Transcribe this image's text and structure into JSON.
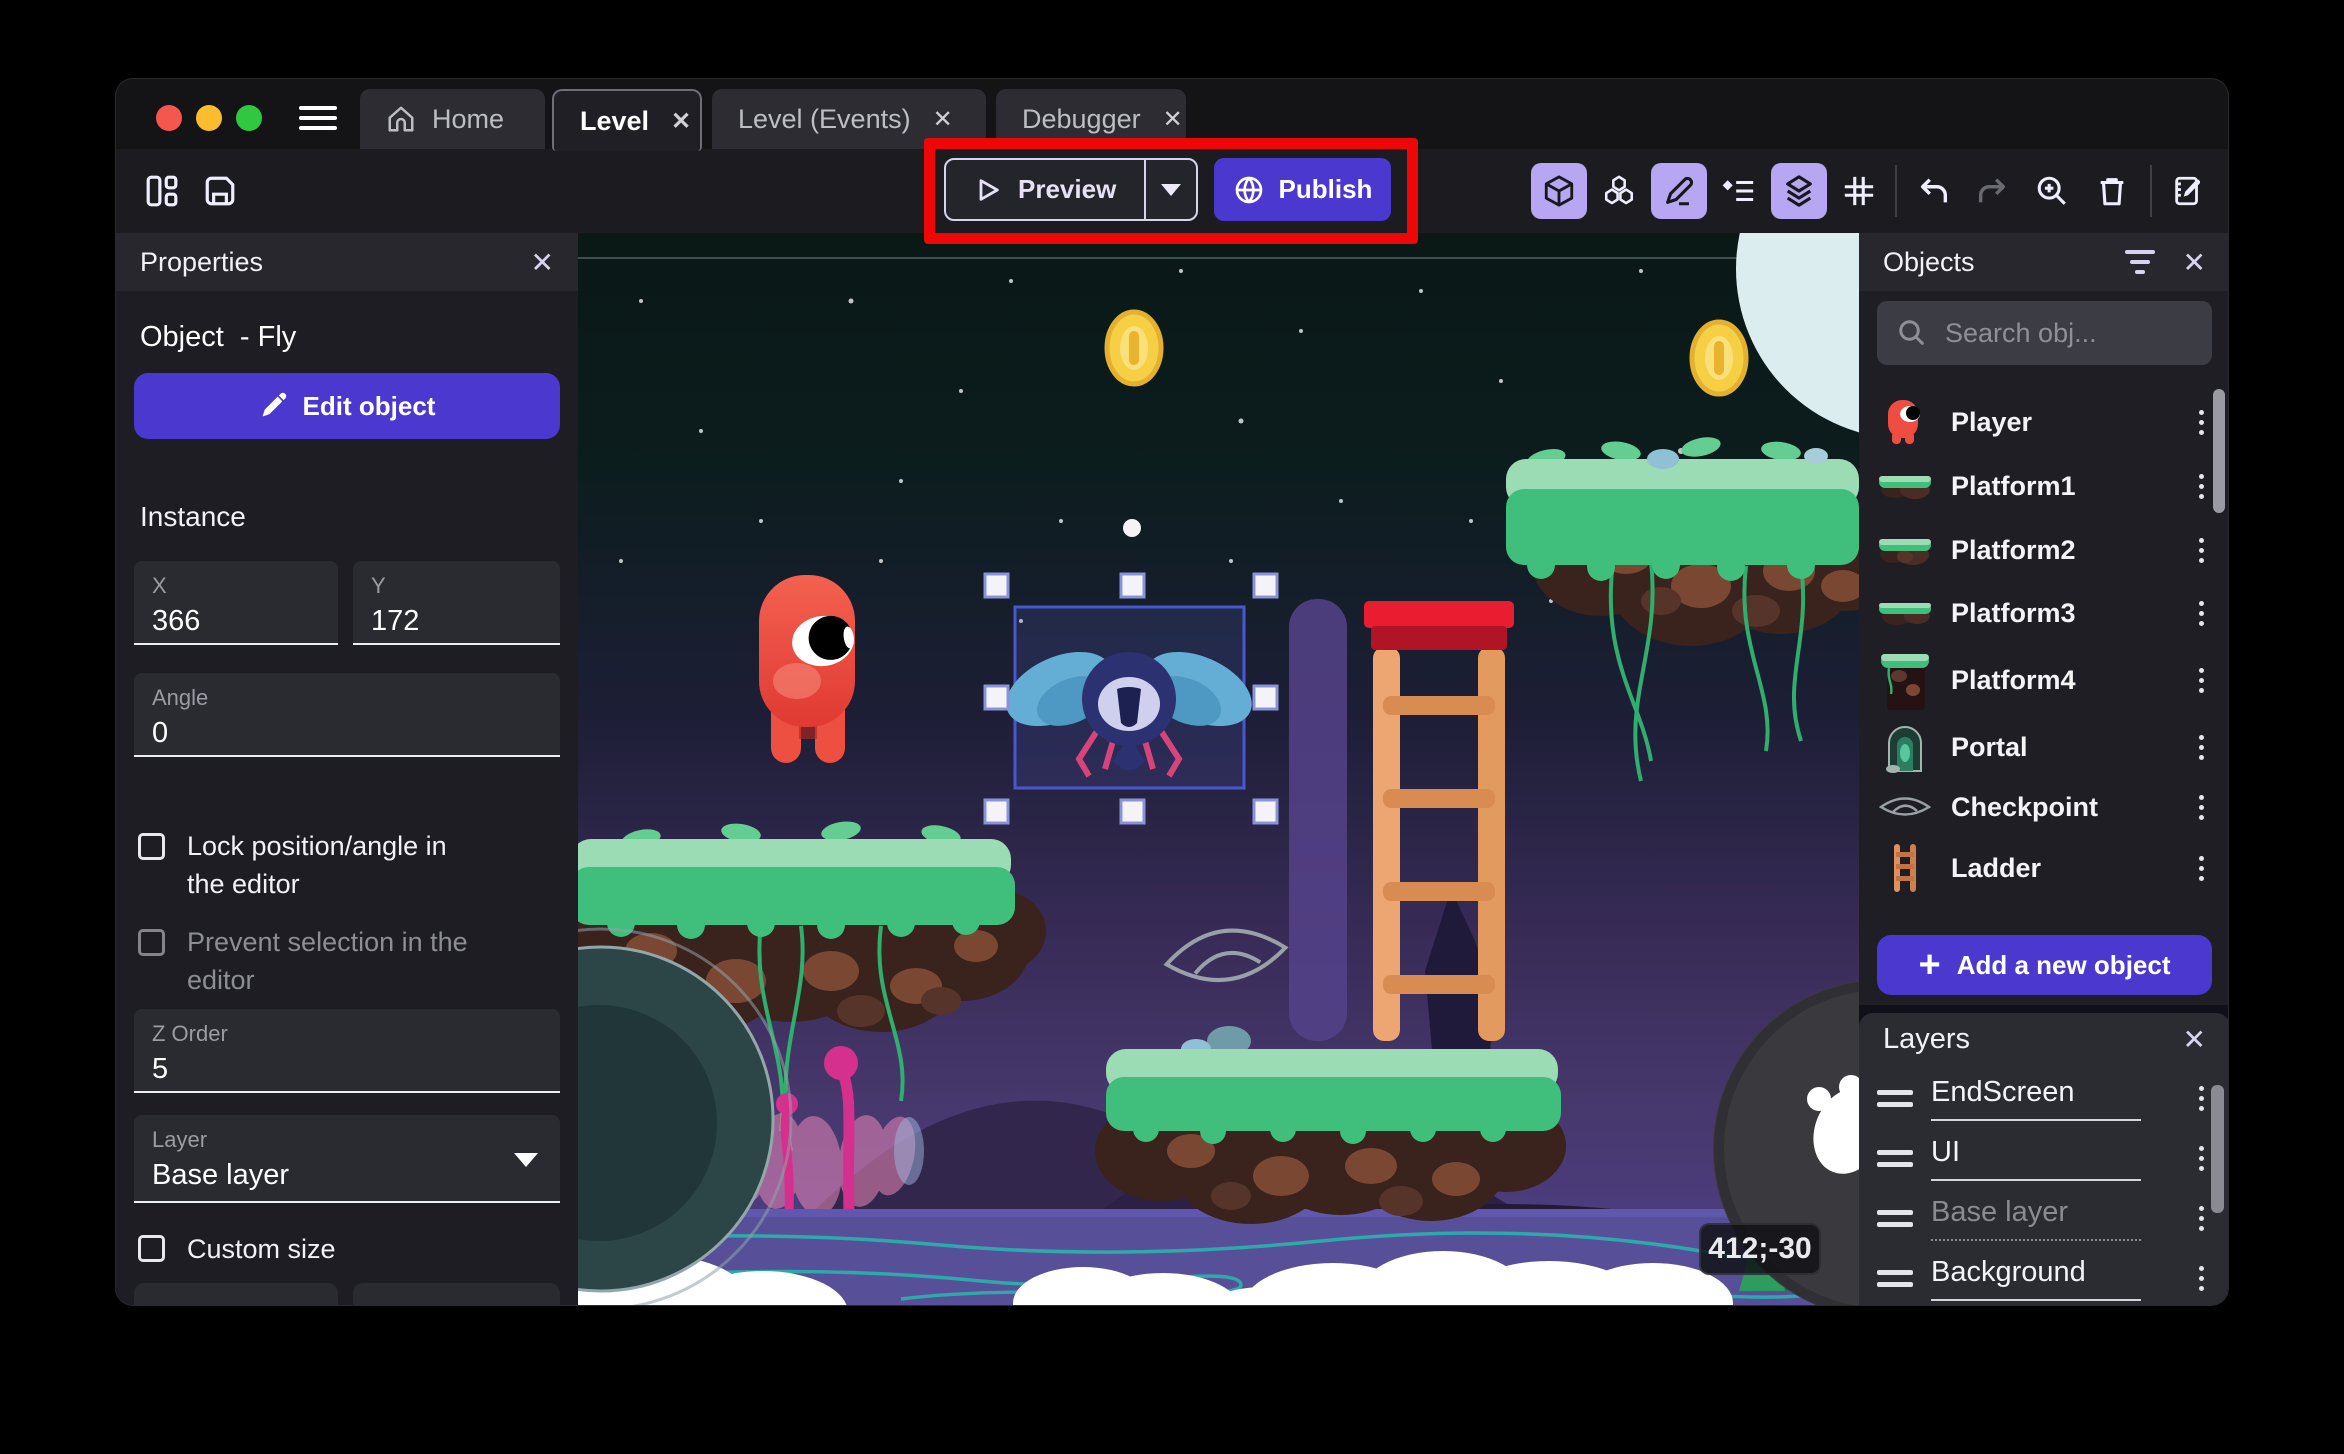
{
  "window": {
    "tabs": [
      {
        "label": "Home"
      },
      {
        "label": "Level"
      },
      {
        "label": "Level (Events)"
      },
      {
        "label": "Debugger"
      }
    ],
    "close_glyph": "✕"
  },
  "toolbar": {
    "preview_label": "Preview",
    "publish_label": "Publish"
  },
  "properties_panel": {
    "title": "Properties",
    "object_heading": "Object  - Fly",
    "edit_object_label": "Edit object",
    "instance_heading": "Instance",
    "fields": {
      "x_label": "X",
      "x_value": "366",
      "y_label": "Y",
      "y_value": "172",
      "angle_label": "Angle",
      "angle_value": "0",
      "z_order_label": "Z Order",
      "z_order_value": "5",
      "layer_label": "Layer",
      "layer_value": "Base layer"
    },
    "checkboxes": {
      "lock_line1": "Lock position/angle in",
      "lock_line2": "the editor",
      "prevent_line1": "Prevent selection in the",
      "prevent_line2": "editor",
      "custom_size": "Custom size"
    }
  },
  "objects_panel": {
    "title": "Objects",
    "search_placeholder": "Search obj...",
    "items": [
      {
        "name": "Player"
      },
      {
        "name": "Platform1"
      },
      {
        "name": "Platform2"
      },
      {
        "name": "Platform3"
      },
      {
        "name": "Platform4"
      },
      {
        "name": "Portal"
      },
      {
        "name": "Checkpoint"
      },
      {
        "name": "Ladder"
      }
    ],
    "add_button": "Add a new object"
  },
  "layers_panel": {
    "title": "Layers",
    "layers": [
      {
        "name": "EndScreen"
      },
      {
        "name": "UI"
      },
      {
        "name": "Base layer"
      },
      {
        "name": "Background"
      }
    ]
  },
  "canvas": {
    "coordinates_badge": "412;-30",
    "selected_object": "Fly"
  },
  "colors": {
    "accent_purple": "#4a38cf",
    "active_icon_bg": "#b7a6f2",
    "annotation_red": "#ee0707",
    "grass_green": "#3fbe7c",
    "coin_gold": "#f6cf45"
  }
}
